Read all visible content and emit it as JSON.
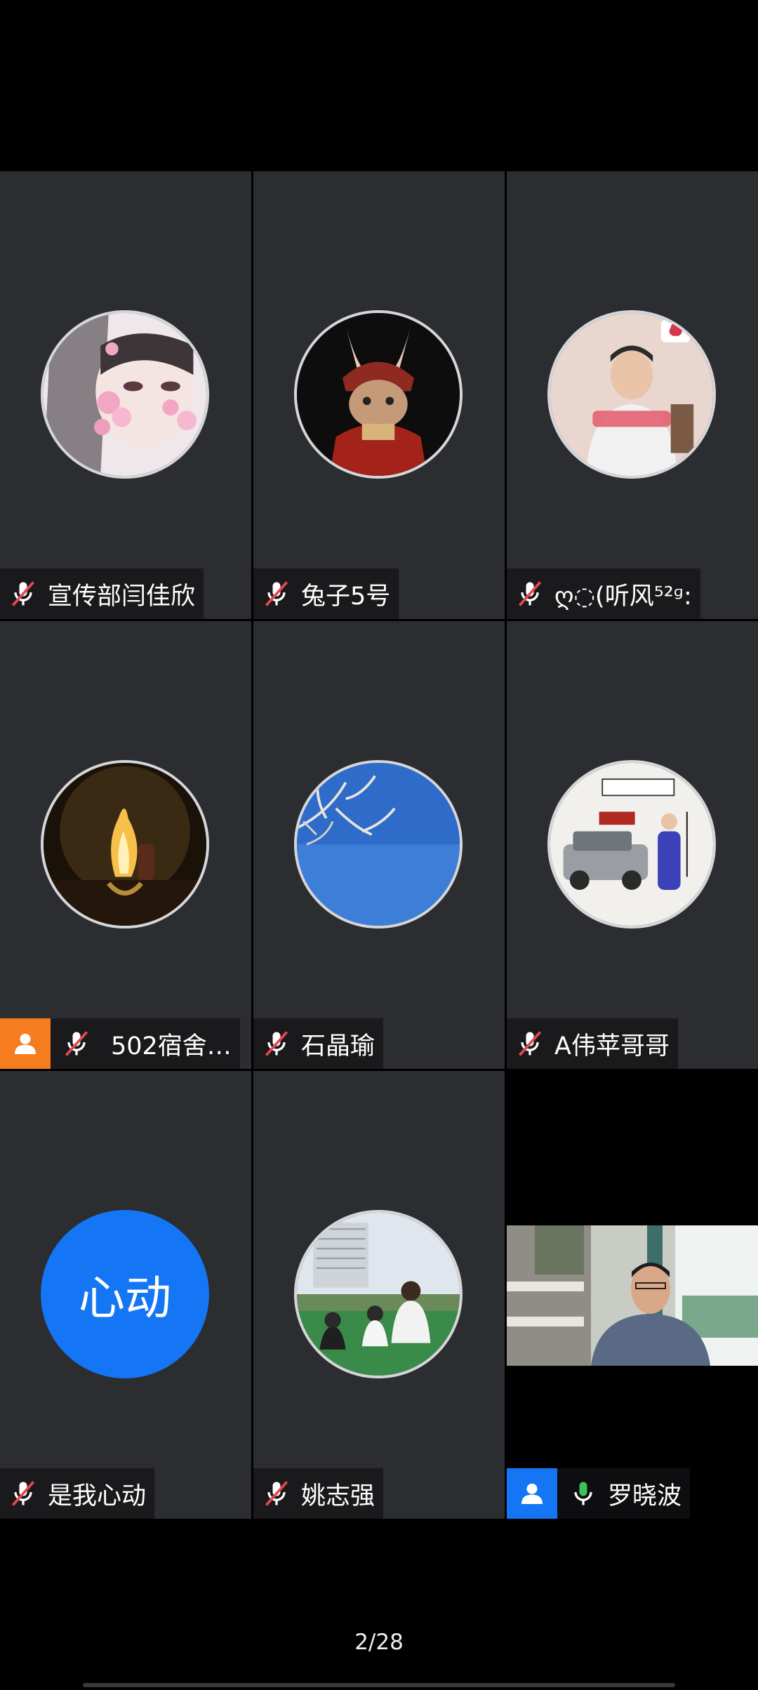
{
  "participants": [
    {
      "name": "宣传部闫佳欣",
      "mic": "muted",
      "avatar": "girl-flowers-avatar"
    },
    {
      "name": "兔子5号",
      "mic": "muted",
      "avatar": "rabbit-warrior-avatar"
    },
    {
      "name": "ღ◌(听风⁵²ᶢ:",
      "mic": "muted",
      "avatar": "man-heart-avatar"
    },
    {
      "name": "502宿舍…",
      "mic": "muted",
      "avatar": "fire-moon-avatar",
      "tag": "person-tag-orange"
    },
    {
      "name": "石晶瑜",
      "mic": "muted",
      "avatar": "sky-branches-avatar"
    },
    {
      "name": "A伟苹哥哥",
      "mic": "muted",
      "avatar": "car-poster-avatar"
    },
    {
      "name": "是我心动",
      "mic": "muted",
      "initials": "心动"
    },
    {
      "name": "姚志强",
      "mic": "muted",
      "avatar": "family-field-avatar"
    },
    {
      "name": "罗晓波",
      "mic": "active",
      "video": "live-camera",
      "tag": "person-tag-blue"
    }
  ],
  "pager": {
    "label": "2/28"
  },
  "colors": {
    "tile": "#2b2d30",
    "muted_red": "#e5484d",
    "active_green": "#3ec15a",
    "orange": "#f57c1f",
    "blue": "#1476f5"
  }
}
